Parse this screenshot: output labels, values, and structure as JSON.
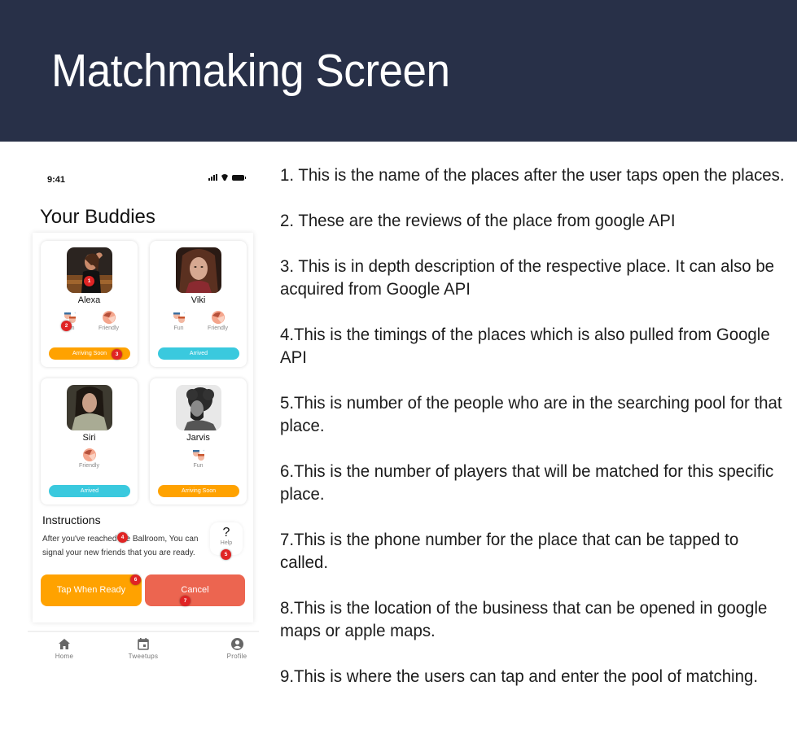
{
  "header": {
    "title": "Matchmaking Screen"
  },
  "phone": {
    "status_bar": {
      "time": "9:41"
    },
    "title": "Your Buddies",
    "buddies": [
      {
        "name": "Alexa",
        "traits": [
          {
            "label": "Fun",
            "icon": "fun-faces-icon"
          },
          {
            "label": "Friendly",
            "icon": "handshake-icon"
          }
        ],
        "status": "Arriving Soon",
        "status_color": "#FFA200"
      },
      {
        "name": "Viki",
        "traits": [
          {
            "label": "Fun",
            "icon": "fun-faces-icon"
          },
          {
            "label": "Friendly",
            "icon": "handshake-icon"
          }
        ],
        "status": "Arrived",
        "status_color": "#3AC9DE"
      },
      {
        "name": "Siri",
        "traits": [
          {
            "label": "Friendly",
            "icon": "handshake-icon"
          }
        ],
        "status": "Arrived",
        "status_color": "#3AC9DE"
      },
      {
        "name": "Jarvis",
        "traits": [
          {
            "label": "Fun",
            "icon": "fun-faces-icon"
          }
        ],
        "status": "Arriving Soon",
        "status_color": "#FFA200"
      }
    ],
    "instructions": {
      "title": "Instructions",
      "text": "After you've reached the Ballroom, You can signal your new friends that you are ready."
    },
    "help": {
      "symbol": "?",
      "label": "Help"
    },
    "buttons": {
      "ready": "Tap When Ready",
      "cancel": "Cancel"
    },
    "annotations": [
      "1",
      "2",
      "3",
      "4",
      "5",
      "6",
      "7"
    ],
    "tabbar": [
      {
        "label": "Home",
        "icon": "home-icon"
      },
      {
        "label": "Tweetups",
        "icon": "calendar-icon"
      },
      {
        "label": "Profile",
        "icon": "profile-icon"
      }
    ]
  },
  "notes": [
    "1. This is the name of the places after the user taps open the places.",
    "2. These are the reviews of the place from google API",
    "3. This is in depth description of the respective place. It can also be acquired from Google API",
    "4.This is the timings of the places which is also pulled from Google API",
    "5.This is number of the people who are in the searching pool for that place.",
    "6.This is the number of players that will be matched for this specific place.",
    "7.This is the phone number for the place that can be tapped to called.",
    "8.This is the location of the business that can be opened in google maps or apple maps.",
    "9.This is where the users can tap and enter the pool of matching."
  ],
  "colors": {
    "header_bg": "#283048",
    "orange": "#FFA200",
    "teal": "#3AC9DE",
    "cancel": "#EC6550",
    "badge": "#E02424"
  }
}
